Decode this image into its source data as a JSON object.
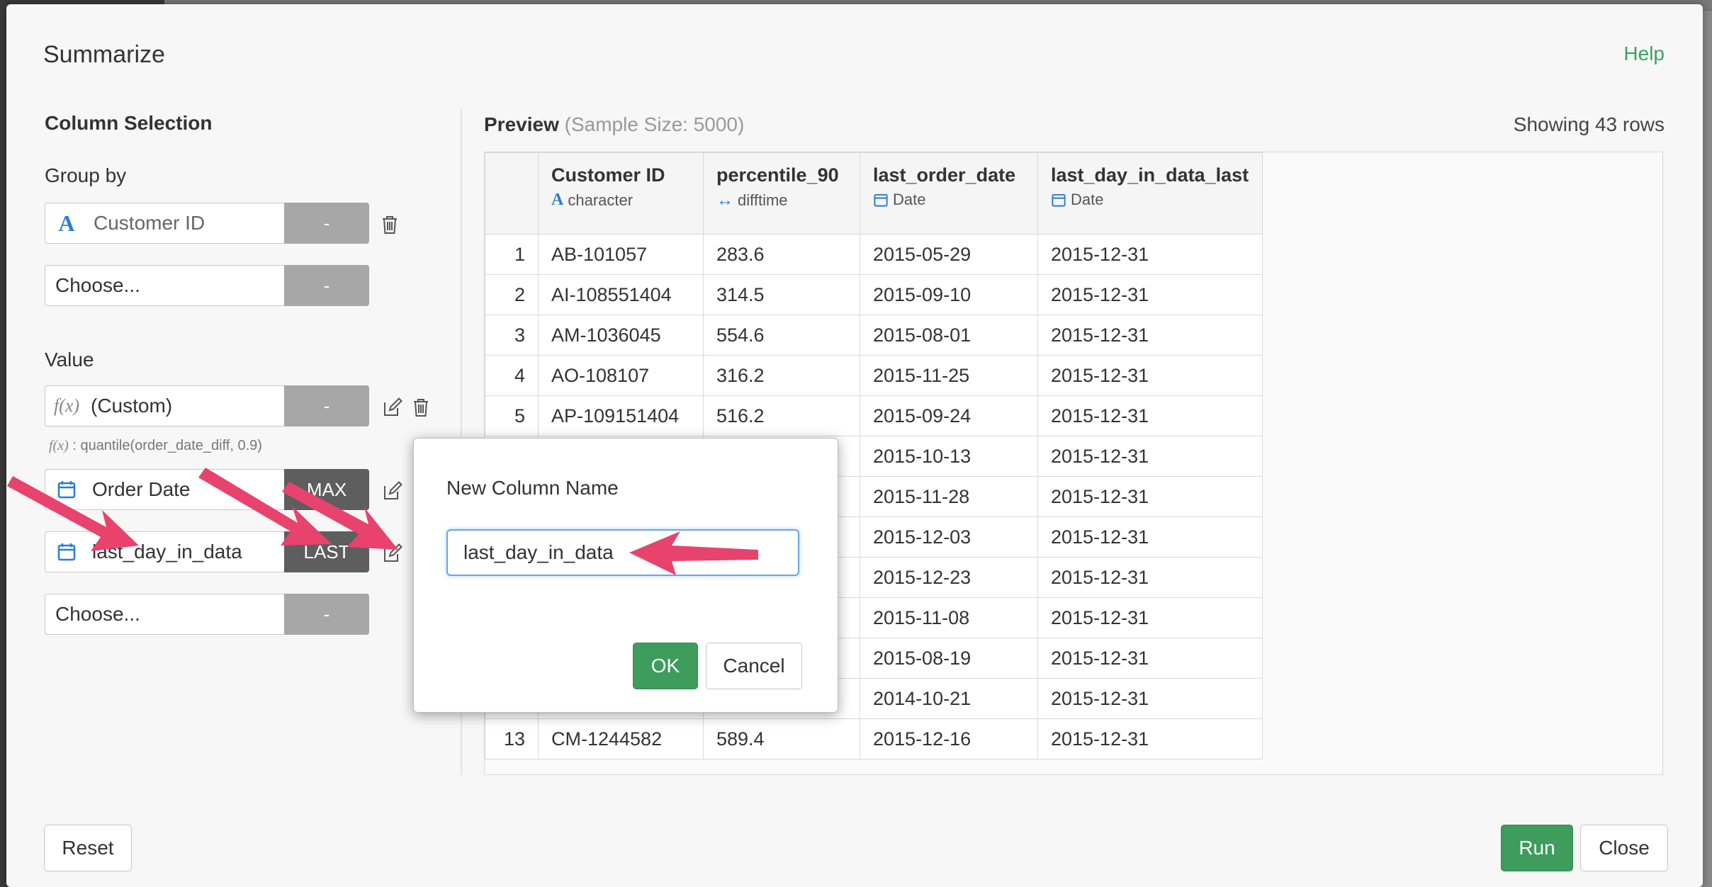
{
  "dialog": {
    "title": "Summarize",
    "help": "Help",
    "column_selection": "Column Selection",
    "group_by_label": "Group by",
    "group_by": [
      {
        "icon": "character-type-icon",
        "text": "Customer ID",
        "agg": "-"
      },
      {
        "icon": "",
        "text": "Choose...",
        "agg": "-"
      }
    ],
    "value_label": "Value",
    "values": [
      {
        "icon": "function-icon",
        "text": "(Custom)",
        "agg": "-"
      },
      {
        "icon": "calendar-icon",
        "text": "Order Date",
        "agg": "MAX"
      },
      {
        "icon": "calendar-icon",
        "text": "last_day_in_data",
        "agg": "LAST"
      },
      {
        "icon": "",
        "text": "Choose...",
        "agg": "-"
      }
    ],
    "formula_hint": ": quantile(order_date_diff, 0.9)",
    "formula_hint_icon": "f(x)",
    "function_icon_text": "f(x)",
    "reset": "Reset",
    "run": "Run",
    "close": "Close"
  },
  "preview": {
    "title": "Preview",
    "sample": "(Sample Size: 5000)",
    "row_count": "Showing 43 rows",
    "columns": [
      {
        "name": "Customer ID",
        "type": "character",
        "type_icon": "A"
      },
      {
        "name": "percentile_90",
        "type": "difftime",
        "type_icon": "↔"
      },
      {
        "name": "last_order_date",
        "type": "Date",
        "type_icon": "calendar"
      },
      {
        "name": "last_day_in_data_last",
        "type": "Date",
        "type_icon": "calendar"
      }
    ],
    "rows": [
      [
        "1",
        "AB-101057",
        "283.6",
        "2015-05-29",
        "2015-12-31"
      ],
      [
        "2",
        "AI-108551404",
        "314.5",
        "2015-09-10",
        "2015-12-31"
      ],
      [
        "3",
        "AM-1036045",
        "554.6",
        "2015-08-01",
        "2015-12-31"
      ],
      [
        "4",
        "AO-108107",
        "316.2",
        "2015-11-25",
        "2015-12-31"
      ],
      [
        "5",
        "AP-109151404",
        "516.2",
        "2015-09-24",
        "2015-12-31"
      ],
      [
        "",
        "",
        "",
        "2015-10-13",
        "2015-12-31"
      ],
      [
        "",
        "",
        "",
        "2015-11-28",
        "2015-12-31"
      ],
      [
        "",
        "",
        "",
        "2015-12-03",
        "2015-12-31"
      ],
      [
        "",
        "",
        "",
        "2015-12-23",
        "2015-12-31"
      ],
      [
        "",
        "",
        "",
        "2015-11-08",
        "2015-12-31"
      ],
      [
        "",
        "",
        "",
        "2015-08-19",
        "2015-12-31"
      ],
      [
        "",
        "",
        "",
        "2014-10-21",
        "2015-12-31"
      ],
      [
        "13",
        "CM-1244582",
        "589.4",
        "2015-12-16",
        "2015-12-31"
      ]
    ]
  },
  "subdialog": {
    "title": "New Column Name",
    "value": "last_day_in_data",
    "ok": "OK",
    "cancel": "Cancel"
  },
  "colors": {
    "accent_green": "#3e9c5c",
    "annotation_arrow": "#e8436d",
    "type_blue": "#2b7cd3"
  }
}
